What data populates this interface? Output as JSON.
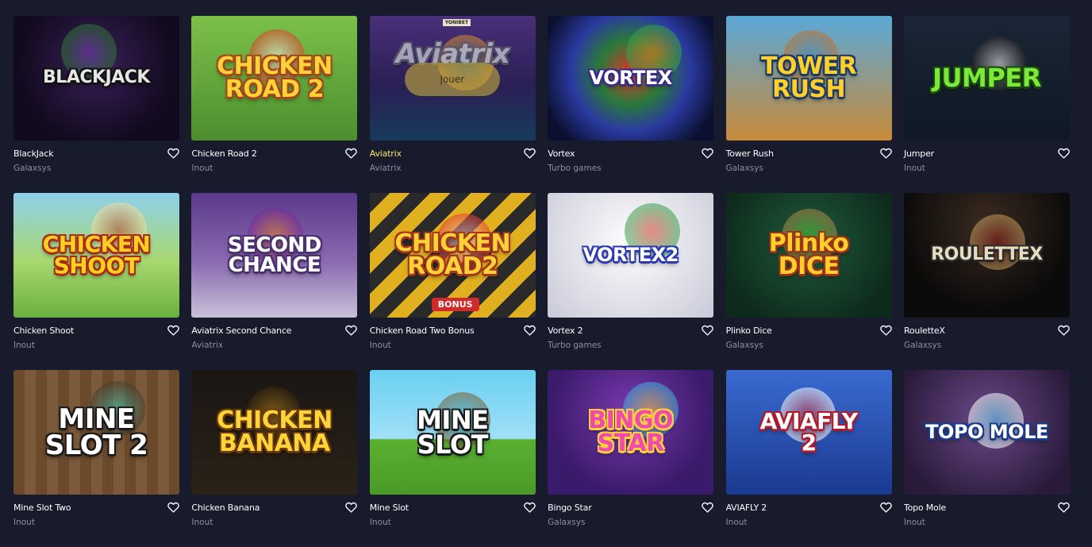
{
  "play_label": "Jouer",
  "games": [
    {
      "title": "BlackJack",
      "provider": "Galaxsys",
      "thumb_text": "BLACKJACK",
      "thumb_bg": "radial-gradient(circle at 50% 40%, #3a1f5a 0%, #120a1e 70%)",
      "text_color": "#e6e6e6",
      "text_stroke": "#111111",
      "font_size": "22",
      "icon": "poker-chip-icon",
      "deco": [
        [
          "#7b3fbf",
          "#2b7a2b"
        ]
      ]
    },
    {
      "title": "Chicken Road 2",
      "provider": "Inout",
      "thumb_text": "CHICKEN\nROAD 2",
      "thumb_bg": "linear-gradient(180deg, #7cc04a 0%, #4c8e2e 100%)",
      "text_color": "#ffd23a",
      "text_stroke": "#a3471a",
      "font_size": "30",
      "icon": "chicken-icon",
      "deco": [
        [
          "#ffffff",
          "#e03a2a"
        ]
      ]
    },
    {
      "title": "Aviatrix",
      "provider": "Aviatrix",
      "thumb_text": "Aviatrix",
      "thumb_bg": "linear-gradient(180deg, #4a2f7a 0%, #2b1f55 55%, #173a5a 100%)",
      "text_color": "#b9b9c9",
      "text_stroke": "#555566",
      "font_size": "34",
      "icon": "airplane-icon",
      "badge": "YONIBET",
      "active": true,
      "deco": [
        [
          "#1f6fa8",
          "#e0902a"
        ]
      ]
    },
    {
      "title": "Vortex",
      "provider": "Turbo games",
      "thumb_text": "VORTEX",
      "thumb_bg": "radial-gradient(circle at 50% 45%, #e0342a 0%, #2a7a3a 30%, #2a3aa0 55%, #0b1030 85%)",
      "text_color": "#ffffff",
      "text_stroke": "#3a2a8a",
      "font_size": "24",
      "icon": "flame-icon",
      "deco": [
        [
          "#ff7a1a",
          "#2fa34a"
        ]
      ]
    },
    {
      "title": "Tower Rush",
      "provider": "Galaxsys",
      "thumb_text": "TOWER\nRUSH",
      "thumb_bg": "linear-gradient(180deg, #5aa8d8 0%, #c88a3a 100%)",
      "text_color": "#ffcf2a",
      "text_stroke": "#1a3a6a",
      "font_size": "30",
      "icon": "tower-icon",
      "deco": [
        [
          "#2a8ad8",
          "#c0702a"
        ]
      ]
    },
    {
      "title": "Jumper",
      "provider": "Inout",
      "thumb_text": "JUMPER",
      "thumb_bg": "linear-gradient(180deg, #1a2636 0%, #0f1824 100%)",
      "text_color": "#7be83a",
      "text_stroke": "#1a4a0a",
      "font_size": "32",
      "icon": "panda-icon",
      "deco": [
        [
          "#ffffff",
          "#222222"
        ]
      ]
    },
    {
      "title": "Chicken Shoot",
      "provider": "Inout",
      "thumb_text": "CHICKEN\nSHOOT",
      "thumb_bg": "linear-gradient(180deg, #8fd0ea 0%, #a8d870 55%, #6ab040 100%)",
      "text_color": "#ffd020",
      "text_stroke": "#a82a1a",
      "font_size": "28",
      "icon": "rooster-icon",
      "deco": [
        [
          "#c0401a",
          "#f0e0a0"
        ]
      ]
    },
    {
      "title": "Aviatrix Second Chance",
      "provider": "Aviatrix",
      "thumb_text": "SECOND\nCHANCE",
      "thumb_bg": "linear-gradient(180deg, #5a3a8a 0%, #8a6ab0 55%, #c8c0d8 100%)",
      "text_color": "#ffffff",
      "text_stroke": "#4a3070",
      "font_size": "26",
      "icon": "biplane-icon",
      "deco": [
        [
          "#f08a1a",
          "#7a2a9a"
        ]
      ]
    },
    {
      "title": "Chicken Road Two Bonus",
      "provider": "Inout",
      "thumb_text": "CHICKEN\nROAD2",
      "thumb_bg": "repeating-linear-gradient(135deg, #2a2a2a 0 18px, #e0b020 18px 36px)",
      "text_color": "#ffd23a",
      "text_stroke": "#a3371a",
      "font_size": "30",
      "icon": "crown-icon",
      "bonus": "BONUS",
      "deco": [
        [
          "#ffffff",
          "#e03a2a"
        ]
      ]
    },
    {
      "title": "Vortex 2",
      "provider": "Turbo games",
      "thumb_text": "VORTEX2",
      "thumb_bg": "radial-gradient(circle at 50% 40%, #ffffff 0%, #e8e8ee 40%, #c8cad8 100%)",
      "text_color": "#ffffff",
      "text_stroke": "#2a3ab0",
      "font_size": "24",
      "icon": "flame-icon",
      "deco": [
        [
          "#e0342a",
          "#2fa34a"
        ]
      ]
    },
    {
      "title": "Plinko Dice",
      "provider": "Galaxsys",
      "thumb_text": "Plinko\nDICE",
      "thumb_bg": "radial-gradient(circle at 50% 40%, #1f5a3a 0%, #0e2a1c 80%)",
      "text_color": "#ffd02a",
      "text_stroke": "#a0301a",
      "font_size": "30",
      "icon": "dice-icon",
      "deco": [
        [
          "#3ad03a",
          "#b08a4a"
        ]
      ]
    },
    {
      "title": "RouletteX",
      "provider": "Galaxsys",
      "thumb_text": "ROULETTEX",
      "thumb_bg": "radial-gradient(circle at 50% 25%, #3a2a20 0%, #0a0a0a 70%)",
      "text_color": "#e8dcc0",
      "text_stroke": "#2a2a2a",
      "font_size": "22",
      "icon": "roulette-wheel-icon",
      "deco": [
        [
          "#8a1a1a",
          "#c8a060"
        ]
      ]
    },
    {
      "title": "Mine Slot Two",
      "provider": "Inout",
      "thumb_text": "MINE\nSLOT 2",
      "thumb_bg": "repeating-linear-gradient(90deg, #6a4a2a 0 14px, #7a5a3a 14px 28px)",
      "text_color": "#ffffff",
      "text_stroke": "#1a1a1a",
      "font_size": "34",
      "icon": "pickaxe-icon",
      "deco": [
        [
          "#3ad0c0",
          "#4a3a2a"
        ]
      ]
    },
    {
      "title": "Chicken Banana",
      "provider": "Inout",
      "thumb_text": "CHICKEN\nBANANA",
      "thumb_bg": "linear-gradient(180deg, #1a1612 0%, #2a2218 100%)",
      "text_color": "#ffd43a",
      "text_stroke": "#6a3a0a",
      "font_size": "30",
      "icon": "banana-icon",
      "deco": [
        [
          "#c8901a",
          "#3a2a10"
        ]
      ]
    },
    {
      "title": "Mine Slot",
      "provider": "Inout",
      "thumb_text": "MINE\nSLOT",
      "thumb_bg": "linear-gradient(180deg, #6ad0f0 0%, #a0e0f8 55%, #5ab030 56%, #4a9a28 100%)",
      "text_color": "#ffffff",
      "text_stroke": "#1a1a1a",
      "font_size": "32",
      "icon": "sword-icon",
      "deco": [
        [
          "#2ab0e0",
          "#7a5a2a"
        ]
      ]
    },
    {
      "title": "Bingo Star",
      "provider": "Galaxsys",
      "thumb_text": "BINGO\nSTAR",
      "thumb_bg": "radial-gradient(circle at 50% 35%, #7a3ab0 0%, #3a1a6a 70%)",
      "text_color": "#f04ab0",
      "text_stroke": "#ffd23a",
      "font_size": "30",
      "icon": "trophy-icon",
      "deco": [
        [
          "#ffd23a",
          "#3ab0e0"
        ]
      ]
    },
    {
      "title": "AVIAFLY 2",
      "provider": "Inout",
      "thumb_text": "AVIAFLY\n2",
      "thumb_bg": "linear-gradient(180deg, #3a6ad0 0%, #1a3a90 100%)",
      "text_color": "#ffffff",
      "text_stroke": "#b01a2a",
      "font_size": "28",
      "icon": "jet-icon",
      "deco": [
        [
          "#d02a2a",
          "#ffffff"
        ]
      ]
    },
    {
      "title": "Topo Mole",
      "provider": "Inout",
      "thumb_text": "TOPO MOLE",
      "thumb_bg": "radial-gradient(circle at 50% 40%, #6a4a8a 0%, #2a1a3a 80%)",
      "text_color": "#ffffff",
      "text_stroke": "#1a3a8a",
      "font_size": "24",
      "icon": "mole-icon",
      "deco": [
        [
          "#5ad0f0",
          "#ffffff"
        ]
      ]
    }
  ]
}
